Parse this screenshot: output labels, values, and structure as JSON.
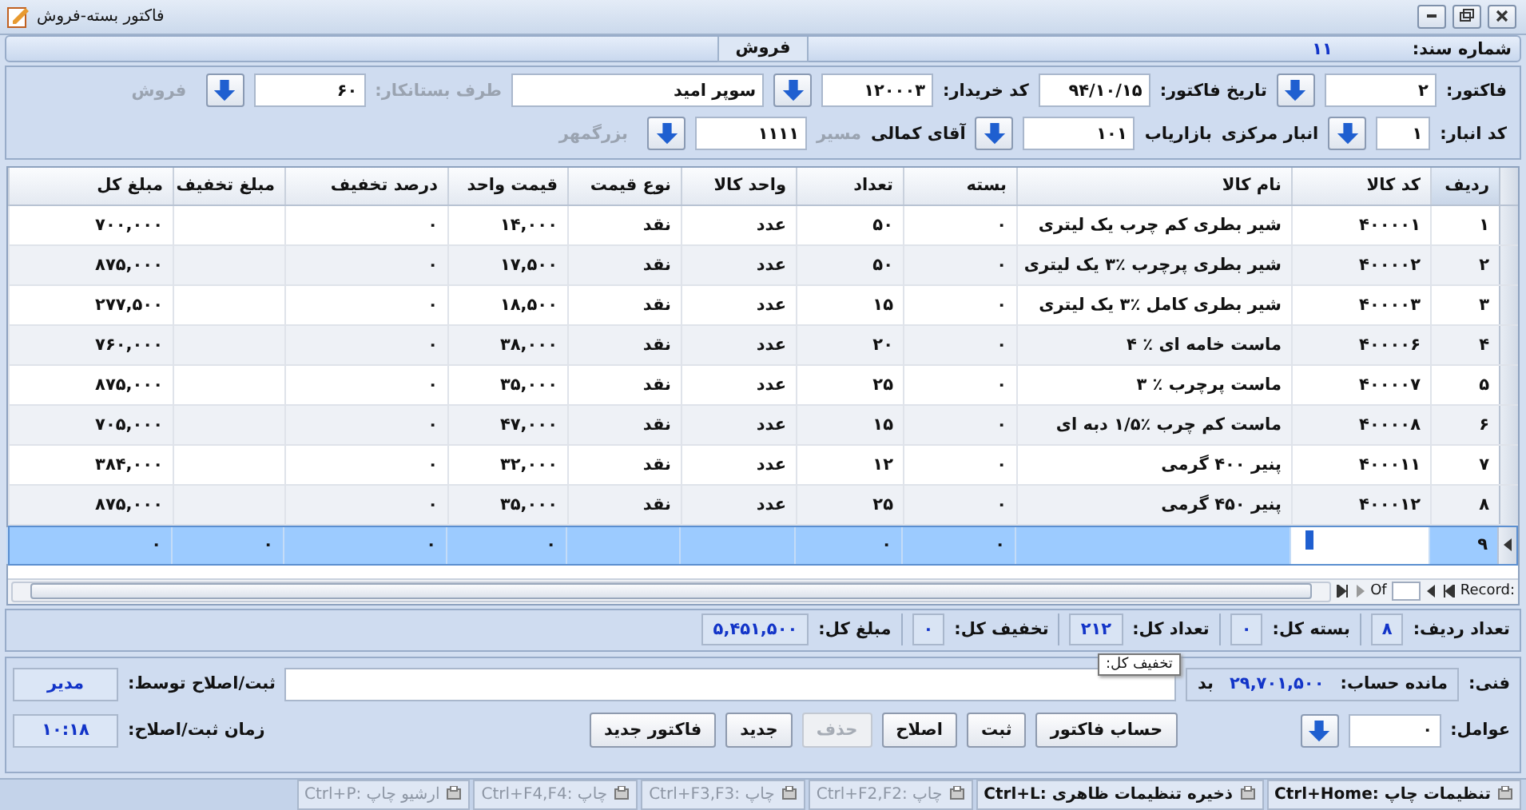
{
  "window": {
    "title": "فاکتور بسته-فروش"
  },
  "section": {
    "title": "فروش",
    "document_label": "شماره سند:",
    "document_number": "۱۱"
  },
  "header": {
    "first_row": [
      {
        "kind": "label",
        "text": "فاکتور:",
        "disabled": false
      },
      {
        "kind": "input",
        "value": "۲"
      },
      {
        "kind": "dropdown"
      },
      {
        "kind": "label",
        "text": "تاریخ فاکتور:",
        "disabled": false
      },
      {
        "kind": "input",
        "value": "۹۴/۱۰/۱۵"
      },
      {
        "kind": "label",
        "text": "کد خریدار:",
        "disabled": false
      },
      {
        "kind": "input",
        "value": "۱۲۰۰۰۳"
      },
      {
        "kind": "dropdown"
      },
      {
        "kind": "wide_input",
        "value": "سوپر امید"
      },
      {
        "kind": "label",
        "text": "طرف بستانکار:",
        "disabled": true
      },
      {
        "kind": "input",
        "value": "۶۰"
      },
      {
        "kind": "dropdown"
      },
      {
        "kind": "label",
        "text": "فروش",
        "disabled": true
      }
    ],
    "second_row": [
      {
        "kind": "label",
        "text": "کد انبار:",
        "disabled": false
      },
      {
        "kind": "small_input",
        "value": "۱"
      },
      {
        "kind": "dropdown"
      },
      {
        "kind": "label",
        "text": "انبار مرکزی",
        "disabled": false
      },
      {
        "kind": "label",
        "text": "بازاریاب",
        "disabled": false
      },
      {
        "kind": "input",
        "value": "۱۰۱"
      },
      {
        "kind": "dropdown"
      },
      {
        "kind": "label",
        "text": "آقای کمالی",
        "disabled": false
      },
      {
        "kind": "label",
        "text": "مسیر",
        "disabled": true
      },
      {
        "kind": "input",
        "value": "۱۱۱۱"
      },
      {
        "kind": "dropdown"
      },
      {
        "kind": "label",
        "text": "بزرگمهر",
        "disabled": true
      }
    ]
  },
  "table": {
    "columns": [
      {
        "label": "ردیف",
        "sorted": true
      },
      {
        "label": "کد کالا",
        "sorted": false
      },
      {
        "label": "نام کالا",
        "sorted": false
      },
      {
        "label": "بسته",
        "sorted": false
      },
      {
        "label": "تعداد",
        "sorted": false
      },
      {
        "label": "واحد کالا",
        "sorted": false
      },
      {
        "label": "نوع قیمت",
        "sorted": false
      },
      {
        "label": "قیمت واحد",
        "sorted": false
      },
      {
        "label": "درصد تخفیف",
        "sorted": false
      },
      {
        "label": "مبلغ تخفیف",
        "sorted": false
      },
      {
        "label": "مبلغ کل",
        "sorted": false
      }
    ],
    "rows": [
      {
        "selected": false,
        "cells": [
          "۱",
          "۴۰۰۰۰۱",
          "شیر بطری کم چرب  یک لیتری",
          "۰",
          "۵۰",
          "عدد",
          "نقد",
          "۱۴,۰۰۰",
          "۰",
          null,
          "۷۰۰,۰۰۰"
        ]
      },
      {
        "selected": false,
        "cells": [
          "۲",
          "۴۰۰۰۰۲",
          "شیر بطری پرچرب ٪۳ یک لیتری",
          "۰",
          "۵۰",
          "عدد",
          "نقد",
          "۱۷,۵۰۰",
          "۰",
          null,
          "۸۷۵,۰۰۰"
        ]
      },
      {
        "selected": false,
        "cells": [
          "۳",
          "۴۰۰۰۰۳",
          "شیر بطری کامل ٪۳ یک لیتری",
          "۰",
          "۱۵",
          "عدد",
          "نقد",
          "۱۸,۵۰۰",
          "۰",
          null,
          "۲۷۷,۵۰۰"
        ]
      },
      {
        "selected": false,
        "cells": [
          "۴",
          "۴۰۰۰۰۶",
          "ماست خامه ای ٪ ۴",
          "۰",
          "۲۰",
          "عدد",
          "نقد",
          "۳۸,۰۰۰",
          "۰",
          null,
          "۷۶۰,۰۰۰"
        ]
      },
      {
        "selected": false,
        "cells": [
          "۵",
          "۴۰۰۰۰۷",
          "ماست  پرچرب ٪ ۳",
          "۰",
          "۲۵",
          "عدد",
          "نقد",
          "۳۵,۰۰۰",
          "۰",
          null,
          "۸۷۵,۰۰۰"
        ]
      },
      {
        "selected": false,
        "cells": [
          "۶",
          "۴۰۰۰۰۸",
          "ماست کم چرب ٪۱/۵ دبه ای",
          "۰",
          "۱۵",
          "عدد",
          "نقد",
          "۴۷,۰۰۰",
          "۰",
          null,
          "۷۰۵,۰۰۰"
        ]
      },
      {
        "selected": false,
        "cells": [
          "۷",
          "۴۰۰۰۱۱",
          "پنیر ۴۰۰ گرمی",
          "۰",
          "۱۲",
          "عدد",
          "نقد",
          "۳۲,۰۰۰",
          "۰",
          null,
          "۳۸۴,۰۰۰"
        ]
      },
      {
        "selected": false,
        "cells": [
          "۸",
          "۴۰۰۰۱۲",
          "پنیر ۴۵۰ گرمی",
          "۰",
          "۲۵",
          "عدد",
          "نقد",
          "۳۵,۰۰۰",
          "۰",
          null,
          "۸۷۵,۰۰۰"
        ]
      },
      {
        "selected": true,
        "cells": [
          "۹",
          null,
          null,
          "۰",
          "۰",
          null,
          null,
          "۰",
          "۰",
          "۰",
          "۰"
        ]
      }
    ],
    "navigator": {
      "record_label": "Record:",
      "of_label": "Of"
    }
  },
  "summary": [
    {
      "label": "تعداد ردیف:",
      "value": "۸"
    },
    {
      "label": "بسته کل:",
      "value": "۰"
    },
    {
      "label": "تعداد کل:",
      "value": "۲۱۲"
    },
    {
      "label": "تخفیف کل:",
      "value": "۰"
    },
    {
      "label": "مبلغ کل:",
      "value": "۵,۴۵۱,۵۰۰"
    }
  ],
  "footer": {
    "technical_label": "فنی:",
    "balance_label": "مانده حساب:",
    "balance": "۲۹,۷۰۱,۵۰۰",
    "balance_side": "بد",
    "editor_label": "ثبت/اصلاح توسط:",
    "editor": "مدیر",
    "agents_label": "عوامل:",
    "agents_value": "۰",
    "buttons": [
      {
        "label": "حساب فاکتور",
        "disabled": false
      },
      {
        "label": "ثبت",
        "disabled": false
      },
      {
        "label": "اصلاح",
        "disabled": false
      },
      {
        "label": "حذف",
        "disabled": true
      },
      {
        "label": "جدید",
        "disabled": false
      },
      {
        "label": "فاکتور جدید",
        "disabled": false
      }
    ],
    "time_label": "زمان ثبت/اصلاح:",
    "time": "۱۰:۱۸"
  },
  "tooltip": {
    "text": "تخفیف کل:"
  },
  "status_bar": [
    {
      "label": "تنظیمات چاپ :Ctrl+Home",
      "disabled": false
    },
    {
      "label": "ذخیره تنظیمات ظاهری :Ctrl+L",
      "disabled": false
    },
    {
      "label": "چاپ :Ctrl+F2,F2",
      "disabled": true
    },
    {
      "label": "چاپ :Ctrl+F3,F3",
      "disabled": true
    },
    {
      "label": "چاپ :Ctrl+F4,F4",
      "disabled": true
    },
    {
      "label": "ارشیو چاپ :Ctrl+P",
      "disabled": true
    }
  ]
}
